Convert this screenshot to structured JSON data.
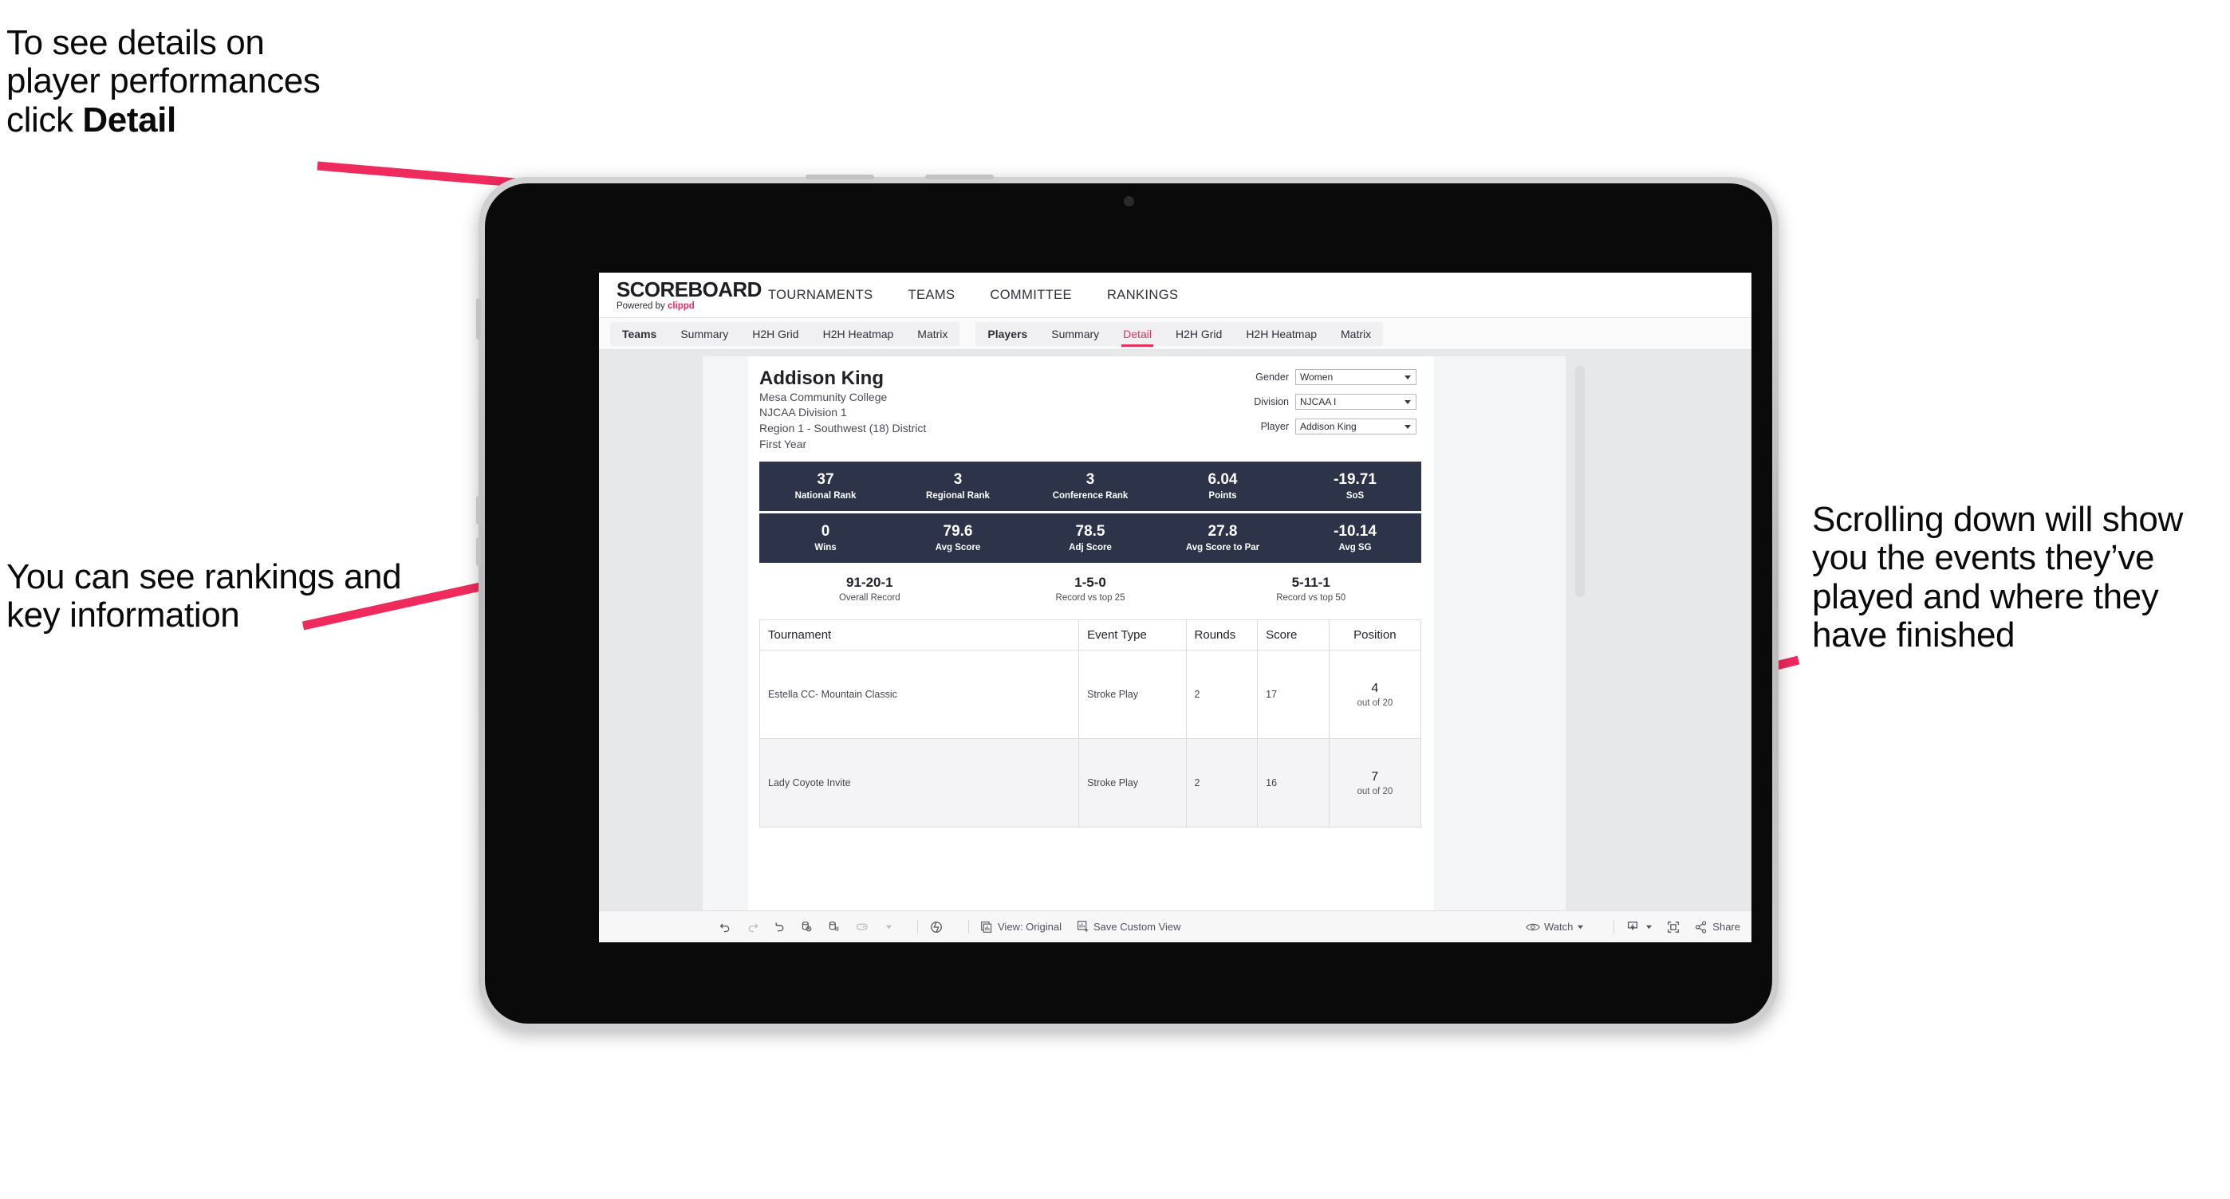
{
  "annotations": {
    "top_left_line1": "To see details on",
    "top_left_line2": "player performances",
    "top_left_line3_prefix": "click ",
    "top_left_line3_bold": "Detail",
    "bottom_left": "You can see rankings and key information",
    "right": "Scrolling down will show you the events they’ve played and where they have finished",
    "arrow_color": "#ef2b5e"
  },
  "app": {
    "brand": {
      "name": "SCOREBOARD",
      "powered_prefix": "Powered by ",
      "powered_brand": "clippd",
      "accent": "#ec2b5b"
    },
    "top_nav": [
      {
        "label": "TOURNAMENTS"
      },
      {
        "label": "TEAMS"
      },
      {
        "label": "COMMITTEE"
      },
      {
        "label": "RANKINGS"
      }
    ],
    "sub_nav": {
      "group_teams": [
        {
          "label": "Teams",
          "lead": true,
          "active": false
        },
        {
          "label": "Summary",
          "lead": false,
          "active": false
        },
        {
          "label": "H2H Grid",
          "lead": false,
          "active": false
        },
        {
          "label": "H2H Heatmap",
          "lead": false,
          "active": false
        },
        {
          "label": "Matrix",
          "lead": false,
          "active": false
        }
      ],
      "group_players": [
        {
          "label": "Players",
          "lead": true,
          "active": false
        },
        {
          "label": "Summary",
          "lead": false,
          "active": false
        },
        {
          "label": "Detail",
          "lead": false,
          "active": true
        },
        {
          "label": "H2H Grid",
          "lead": false,
          "active": false
        },
        {
          "label": "H2H Heatmap",
          "lead": false,
          "active": false
        },
        {
          "label": "Matrix",
          "lead": false,
          "active": false
        }
      ],
      "active_tab": "Detail",
      "active_color": "#e5315c"
    }
  },
  "player": {
    "name": "Addison King",
    "school": "Mesa Community College",
    "division": "NJCAA Division 1",
    "region": "Region 1 - Southwest (18) District",
    "class_year": "First Year"
  },
  "filters": [
    {
      "label": "Gender",
      "value": "Women"
    },
    {
      "label": "Division",
      "value": "NJCAA I"
    },
    {
      "label": "Player",
      "value": "Addison King"
    }
  ],
  "stat_band_color": "#2d3349",
  "stats_row1": [
    {
      "value": "37",
      "label": "National Rank"
    },
    {
      "value": "3",
      "label": "Regional Rank"
    },
    {
      "value": "3",
      "label": "Conference Rank"
    },
    {
      "value": "6.04",
      "label": "Points"
    },
    {
      "value": "-19.71",
      "label": "SoS"
    }
  ],
  "stats_row2": [
    {
      "value": "0",
      "label": "Wins"
    },
    {
      "value": "79.6",
      "label": "Avg Score"
    },
    {
      "value": "78.5",
      "label": "Adj Score"
    },
    {
      "value": "27.8",
      "label": "Avg Score to Par"
    },
    {
      "value": "-10.14",
      "label": "Avg SG"
    }
  ],
  "records": [
    {
      "value": "91-20-1",
      "label": "Overall Record"
    },
    {
      "value": "1-5-0",
      "label": "Record vs top 25"
    },
    {
      "value": "5-11-1",
      "label": "Record vs top 50"
    }
  ],
  "tournament_table": {
    "columns": [
      "Tournament",
      "Event Type",
      "Rounds",
      "Score",
      "Position"
    ],
    "rows": [
      {
        "tournament": "Estella CC- Mountain Classic",
        "event_type": "Stroke Play",
        "rounds": "2",
        "score": "17",
        "position": "4",
        "position_of": "out of 20"
      },
      {
        "tournament": "Lady Coyote Invite",
        "event_type": "Stroke Play",
        "rounds": "2",
        "score": "16",
        "position": "7",
        "position_of": "out of 20"
      }
    ]
  },
  "toolbar": {
    "view_label": "View: Original",
    "save_label": "Save Custom View",
    "watch_label": "Watch",
    "share_label": "Share"
  }
}
